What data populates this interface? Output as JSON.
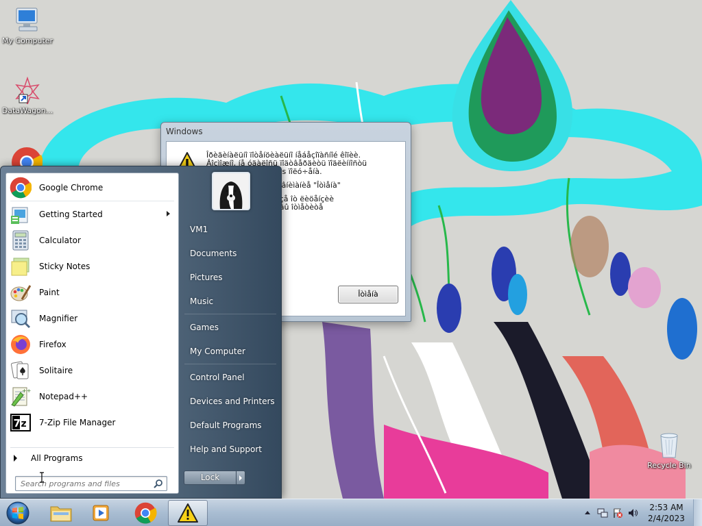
{
  "desktop": {
    "icons": [
      {
        "label": "My Computer",
        "icon": "computer-icon"
      },
      {
        "label": "DataWagon...",
        "icon": "datawagon-shortcut-icon"
      },
      {
        "label": "Recycle Bin",
        "icon": "recycle-bin-icon"
      }
    ]
  },
  "dialog": {
    "title": "Windows",
    "icon": "warning-icon",
    "message_1": "Îðèãèíàëüíî ïîòåíöèàëüíî íåáåçîïàñíîé êîïèè.\nÂîçìîæíî, íå óäàëîñü ïîäòâåðäèòü ïîäëèííîñòü\nâàøåé êîïèè Windows ïîëó÷åíà.",
    "message_2": "...ndows îáæàëîâàíî âíèìàíèå \"Îòìåíà\"",
    "message_3": "...âåäîìëåíèÿ îá îòêàçå îò ëèöåíçèè\n...íûé çàêàç\". Åñëè âû îòìåòèòå\n...ëè óäàëèòü.",
    "ok_label": "Îòìåíà"
  },
  "start_menu": {
    "programs": [
      {
        "label": "Google Chrome",
        "icon": "chrome-icon",
        "has_submenu": false
      },
      {
        "label": "Getting Started",
        "icon": "getting-started-icon",
        "has_submenu": true
      },
      {
        "label": "Calculator",
        "icon": "calculator-icon",
        "has_submenu": false
      },
      {
        "label": "Sticky Notes",
        "icon": "sticky-notes-icon",
        "has_submenu": false
      },
      {
        "label": "Paint",
        "icon": "paint-icon",
        "has_submenu": false
      },
      {
        "label": "Magnifier",
        "icon": "magnifier-icon",
        "has_submenu": false
      },
      {
        "label": "Firefox",
        "icon": "firefox-icon",
        "has_submenu": false
      },
      {
        "label": "Solitaire",
        "icon": "solitaire-icon",
        "has_submenu": false
      },
      {
        "label": "Notepad++",
        "icon": "notepadpp-icon",
        "has_submenu": false
      },
      {
        "label": "7-Zip File Manager",
        "icon": "7zip-icon",
        "has_submenu": false
      }
    ],
    "all_programs_label": "All Programs",
    "search_placeholder": "Search programs and files",
    "places": [
      {
        "label": "VM1"
      },
      {
        "label": "Documents"
      },
      {
        "label": "Pictures"
      },
      {
        "label": "Music"
      },
      {
        "label": "Games"
      },
      {
        "label": "My Computer"
      },
      {
        "label": "Control Panel"
      },
      {
        "label": "Devices and Printers"
      },
      {
        "label": "Default Programs"
      },
      {
        "label": "Help and Support"
      }
    ],
    "lock_label": "Lock"
  },
  "taskbar": {
    "pinned": [
      {
        "name": "windows-explorer",
        "icon": "folder-icon"
      },
      {
        "name": "media-player",
        "icon": "media-player-icon"
      },
      {
        "name": "chrome",
        "icon": "chrome-icon"
      },
      {
        "name": "warning-dialog",
        "icon": "warning-icon",
        "active": true
      }
    ],
    "clock_time": "2:53 AM",
    "clock_date": "2/4/2023"
  }
}
